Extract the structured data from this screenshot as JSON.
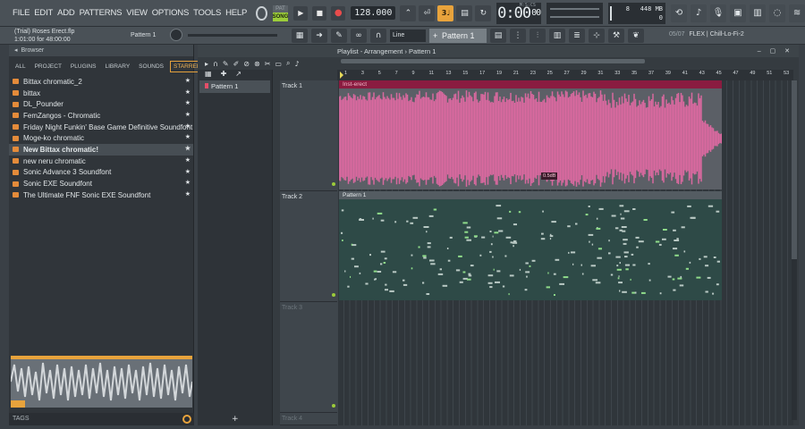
{
  "menu": [
    "FILE",
    "EDIT",
    "ADD",
    "PATTERNS",
    "VIEW",
    "OPTIONS",
    "TOOLS",
    "HELP"
  ],
  "transport": {
    "pat_label": "PAT",
    "song_label": "SONG",
    "tempo": "128.000",
    "time_main": "0:00",
    "time_ms": "00",
    "time_unit": "M:S:CS"
  },
  "cpu": {
    "cpu_value": "8",
    "ram_value": "448 MB",
    "poly_value": "0"
  },
  "project": {
    "file_line": "(Trial) Roses Erect.flp",
    "time_line": "1:01:00 for 48:00:00",
    "pattern_tag": "Pattern 1"
  },
  "tools": {
    "snap": "Line",
    "pattern": "Pattern 1",
    "plugin_index": "05/07",
    "plugin_name": "FLEX | Chill-Lo-Fi-2"
  },
  "browser": {
    "title": "Browser",
    "tabs": [
      "ALL",
      "PROJECT",
      "PLUGINS",
      "LIBRARY",
      "SOUNDS",
      "STARRED"
    ],
    "active_tab": "STARRED",
    "items": [
      "Bittax chromatic_2",
      "bittax",
      "DL_Pounder",
      "FemZangos - Chromatic",
      "Friday Night Funkin' Base Game Definitive Soundfont",
      "Moge-ko chromatic",
      "New Bittax chromatic!",
      "new neru chromatic",
      "Sonic Advance 3 Soundfont",
      "Sonic EXE Soundfont",
      "The Ultimate FNF Sonic EXE Soundfont"
    ],
    "tags_label": "TAGS"
  },
  "playlist": {
    "title": "Playlist - Arrangement › Pattern 1",
    "pattern_list": [
      "Pattern 1"
    ],
    "tracks": [
      "Track 1",
      "Track 2",
      "Track 3",
      "Track 4"
    ],
    "ruler": [
      "1",
      "3",
      "5",
      "7",
      "9",
      "11",
      "13",
      "15",
      "17",
      "19",
      "21",
      "23",
      "25",
      "27",
      "29",
      "31",
      "33",
      "35",
      "37",
      "39",
      "41",
      "43",
      "45",
      "47",
      "49",
      "51",
      "53"
    ],
    "audio_clip_name": "Inst-erect",
    "audio_clip_volume": "0.5dB",
    "pattern_clip_name": "Pattern 1"
  },
  "colors": {
    "accent_orange": "#e8a33c",
    "song_green": "#9ccc3a",
    "audio_clip": "#d9699f",
    "audio_clip_head": "#8a1c40",
    "pattern_notes": "#8fdc8a"
  }
}
